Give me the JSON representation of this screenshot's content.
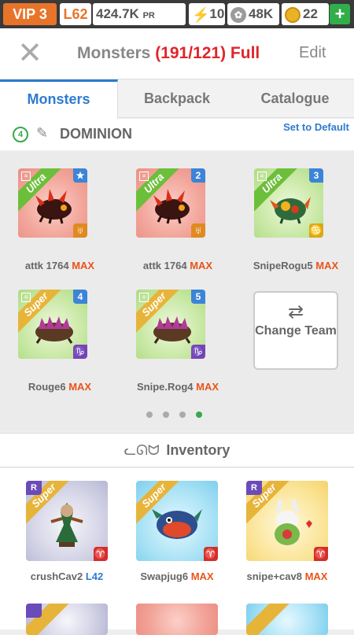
{
  "status": {
    "vip": "VIP 3",
    "level": "L62",
    "pr_value": "424.7K",
    "pr_unit": "PR",
    "energy": "10",
    "paws": "48K",
    "coins": "22",
    "plus": "+"
  },
  "header": {
    "title": "Monsters",
    "count": "(191/121) Full",
    "edit": "Edit"
  },
  "tabs": [
    "Monsters",
    "Backpack",
    "Catalogue"
  ],
  "team": {
    "badge": "4",
    "name": "DOMINION",
    "set_default": "Set to Default",
    "change_team": "Change Team",
    "max_label": "MAX",
    "slots": [
      {
        "name": "attk 1764",
        "rarity": "Ultra",
        "tag": "★",
        "sign": "♅"
      },
      {
        "name": "attk 1764",
        "rarity": "Ultra",
        "tag": "2",
        "sign": "♅"
      },
      {
        "name": "SnipeRogu5",
        "rarity": "Ultra",
        "tag": "3",
        "sign": "♋"
      },
      {
        "name": "Rouge6",
        "rarity": "Super",
        "tag": "4",
        "sign": "♑"
      },
      {
        "name": "Snipe.Rog4",
        "rarity": "Super",
        "tag": "5",
        "sign": "♑"
      }
    ]
  },
  "pager": {
    "pages": 4,
    "active": 4
  },
  "inventory": {
    "title": "Inventory",
    "items": [
      {
        "name": "crushCav2",
        "level": "L42",
        "rarity": "Super",
        "rtag": "R",
        "sign": "♈"
      },
      {
        "name": "Swapjug6",
        "level": "MAX",
        "rarity": "Super",
        "rtag": "",
        "sign": "♈"
      },
      {
        "name": "snipe+cav8",
        "level": "MAX",
        "rarity": "Super",
        "rtag": "R",
        "sign": "♈"
      }
    ]
  },
  "colors": {
    "accent": "#2e7bcf",
    "max": "#e8541b",
    "full": "#e0252b",
    "vip": "#e8742a",
    "green": "#36a94b"
  }
}
